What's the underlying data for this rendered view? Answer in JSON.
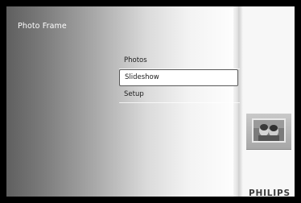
{
  "app": {
    "title": "Photo Frame",
    "brand": "PHILIPS"
  },
  "menu": {
    "items": [
      {
        "label": "Photos"
      },
      {
        "label": "Slideshow",
        "selected": true
      },
      {
        "label": "Setup"
      }
    ]
  },
  "colors": {
    "background": "#000000",
    "panel_light": "#f7f7f7",
    "selection_border": "#595959",
    "text": "#202020"
  },
  "icons": {
    "thumbnail": "photo-thumbnail-icon"
  }
}
